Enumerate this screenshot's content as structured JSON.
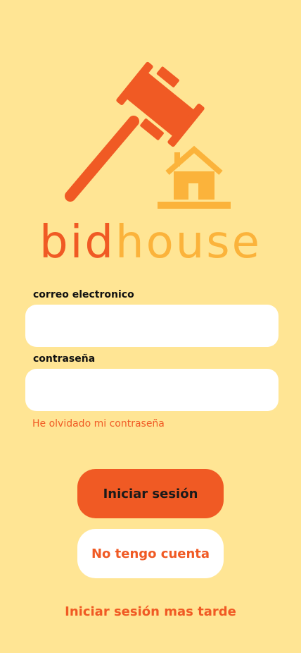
{
  "brand": {
    "name_part1": "bid",
    "name_part2": "house",
    "primary_color": "#F05A24",
    "secondary_color": "#FBB33B",
    "background_color": "#FFE594"
  },
  "icons": {
    "logo": "gavel-icon",
    "house": "house-icon"
  },
  "form": {
    "email_label": "correo electronico",
    "email_value": "",
    "password_label": "contraseña",
    "password_value": "",
    "forgot_password": "He olvidado mi contraseña"
  },
  "actions": {
    "login_label": "Iniciar sesión",
    "register_label": "No tengo cuenta",
    "later_label": "Iniciar sesión mas tarde"
  }
}
